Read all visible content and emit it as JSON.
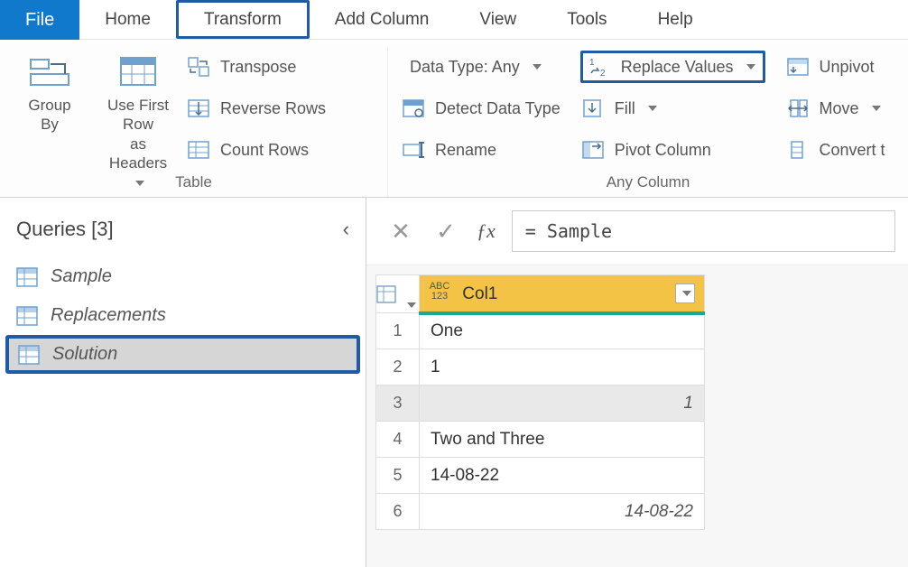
{
  "menubar": {
    "tabs": [
      "File",
      "Home",
      "Transform",
      "Add Column",
      "View",
      "Tools",
      "Help"
    ],
    "highlighted_index": 2
  },
  "ribbon": {
    "groups": [
      {
        "title": "Table",
        "big": [
          {
            "label_lines": [
              "Group",
              "By"
            ],
            "icon": "group-by-icon"
          },
          {
            "label_lines": [
              "Use First Row",
              "as Headers"
            ],
            "icon": "first-row-headers-icon",
            "has_dd": true
          }
        ],
        "small": [
          {
            "label": "Transpose",
            "icon": "transpose-icon"
          },
          {
            "label": "Reverse Rows",
            "icon": "reverse-rows-icon"
          },
          {
            "label": "Count Rows",
            "icon": "count-rows-icon"
          }
        ]
      },
      {
        "title": "Any Column",
        "left_small": [
          {
            "label": "Data Type: Any",
            "icon": "",
            "has_dd": true,
            "icon_hidden": true
          },
          {
            "label": "Detect Data Type",
            "icon": "detect-type-icon"
          },
          {
            "label": "Rename",
            "icon": "rename-icon"
          }
        ],
        "mid_small": [
          {
            "label": "Replace Values",
            "icon": "replace-values-icon",
            "has_dd": true,
            "highlighted": true
          },
          {
            "label": "Fill",
            "icon": "fill-icon",
            "has_dd": true
          },
          {
            "label": "Pivot Column",
            "icon": "pivot-icon"
          }
        ],
        "right_small": [
          {
            "label": "Unpivot",
            "icon": "unpivot-icon",
            "truncated": true
          },
          {
            "label": "Move",
            "icon": "move-icon",
            "has_dd": true
          },
          {
            "label": "Convert t",
            "icon": "convert-icon",
            "truncated": true
          }
        ]
      }
    ]
  },
  "queries": {
    "title_prefix": "Queries",
    "count_display": "[3]",
    "items": [
      {
        "name": "Sample"
      },
      {
        "name": "Replacements"
      },
      {
        "name": "Solution",
        "selected": true,
        "highlighted": true
      }
    ]
  },
  "formula": {
    "value": "= Sample"
  },
  "grid": {
    "column_header": "Col1",
    "type_badge_lines": [
      "ABC",
      "123"
    ],
    "rows": [
      {
        "num": "1",
        "value": "One",
        "align": "left"
      },
      {
        "num": "2",
        "value": "1",
        "align": "left"
      },
      {
        "num": "3",
        "value": "1",
        "align": "right",
        "selected": true
      },
      {
        "num": "4",
        "value": "Two and Three",
        "align": "left"
      },
      {
        "num": "5",
        "value": "14-08-22",
        "align": "left"
      },
      {
        "num": "6",
        "value": "14-08-22",
        "align": "right"
      }
    ]
  }
}
